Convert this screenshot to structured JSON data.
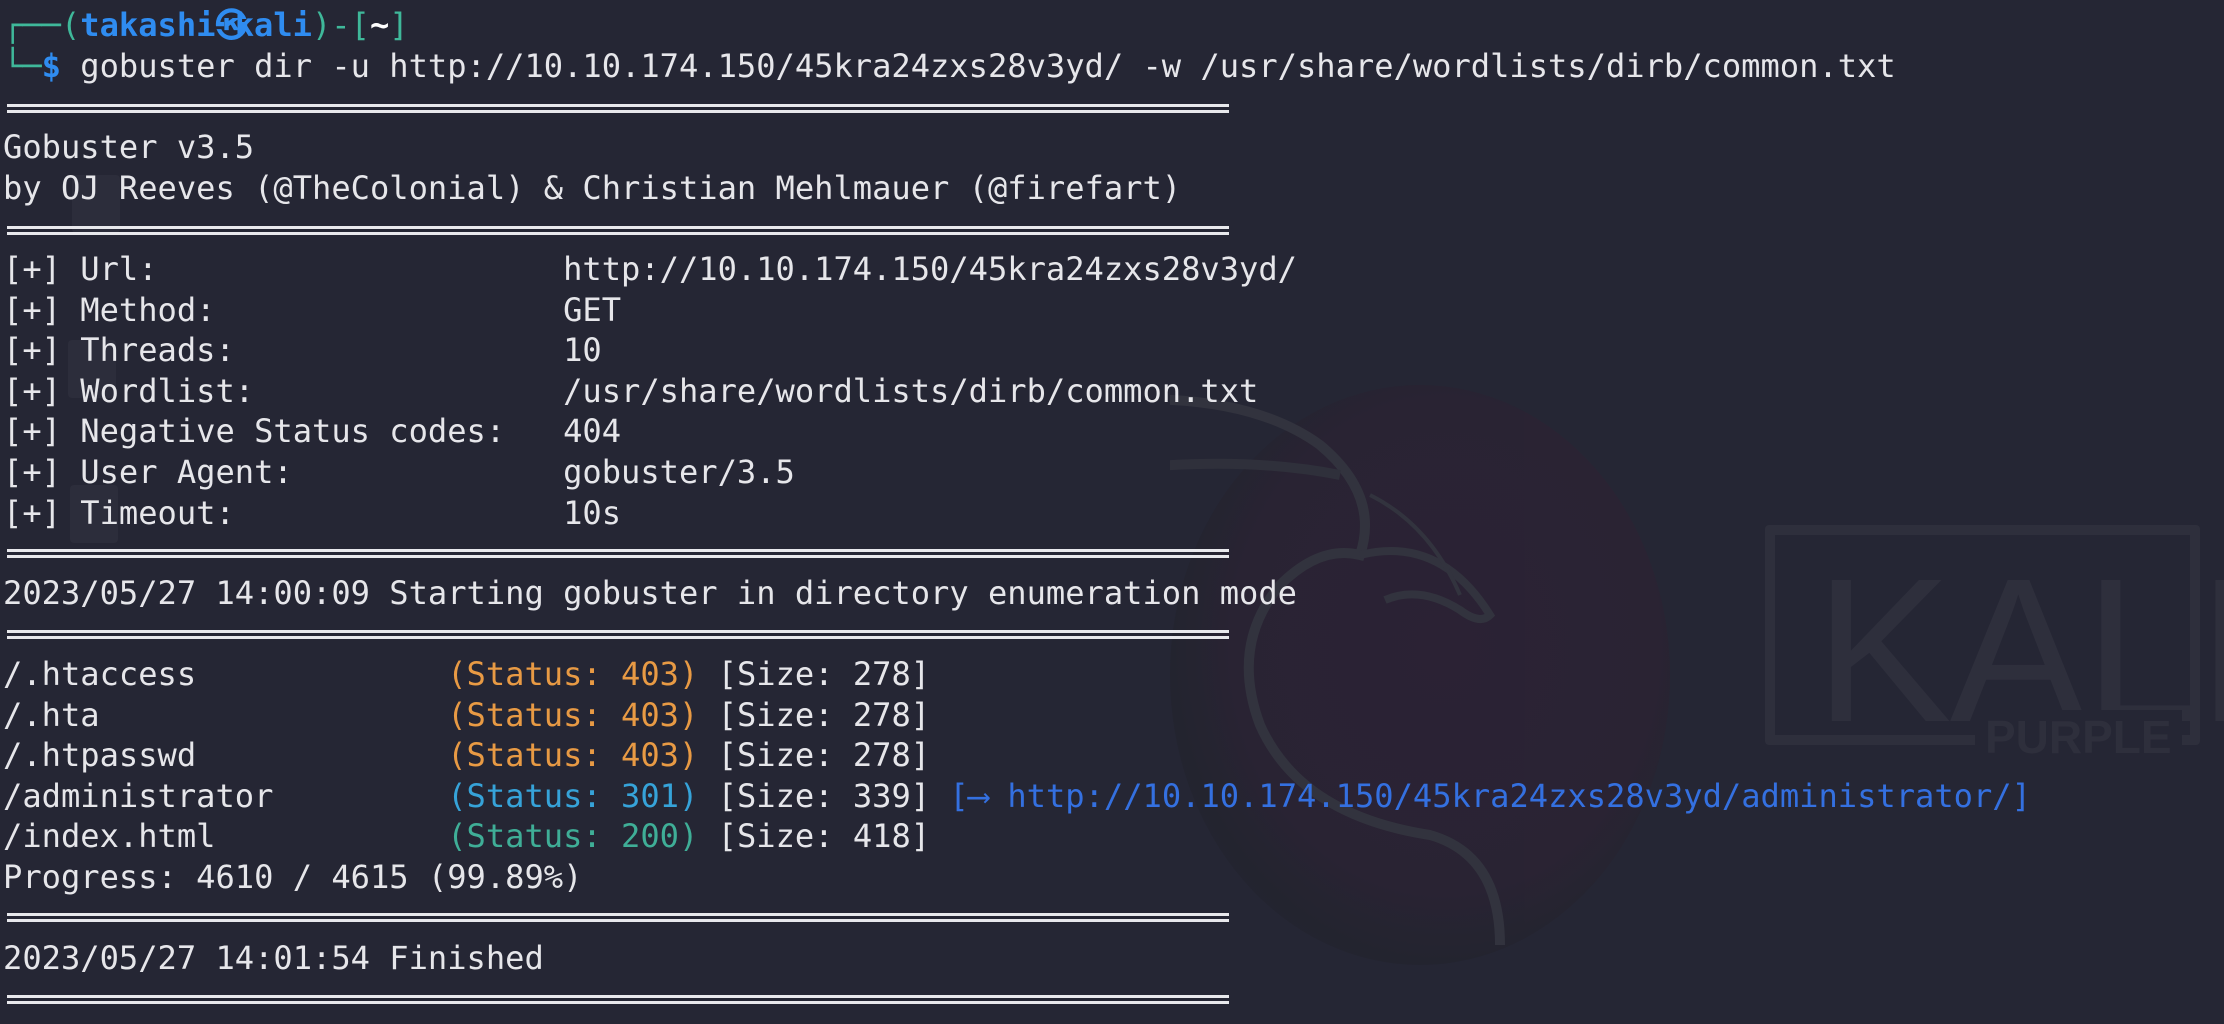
{
  "prompt": {
    "user": "takashi",
    "host": "kali",
    "cwd": "~",
    "symbol": "$",
    "separator_icon": "kali-circle-icon",
    "command": "gobuster dir -u http://10.10.174.150/45kra24zxs28v3yd/ -w /usr/share/wordlists/dirb/common.txt"
  },
  "banner": {
    "title": "Gobuster v3.5",
    "authors": "by OJ Reeves (@TheColonial) & Christian Mehlmauer (@firefart)"
  },
  "config": [
    {
      "prefix": "[+]",
      "key": "Url:                     ",
      "value": "http://10.10.174.150/45kra24zxs28v3yd/"
    },
    {
      "prefix": "[+]",
      "key": "Method:                  ",
      "value": "GET"
    },
    {
      "prefix": "[+]",
      "key": "Threads:                 ",
      "value": "10"
    },
    {
      "prefix": "[+]",
      "key": "Wordlist:                ",
      "value": "/usr/share/wordlists/dirb/common.txt"
    },
    {
      "prefix": "[+]",
      "key": "Negative Status codes:   ",
      "value": "404"
    },
    {
      "prefix": "[+]",
      "key": "User Agent:              ",
      "value": "gobuster/3.5"
    },
    {
      "prefix": "[+]",
      "key": "Timeout:                 ",
      "value": "10s"
    }
  ],
  "start_message": "2023/05/27 14:00:09 Starting gobuster in directory enumeration mode",
  "results": [
    {
      "path": "/.htaccess            ",
      "status": "(Status: 403)",
      "size": "[Size: 278]",
      "status_class": "orange"
    },
    {
      "path": "/.hta                 ",
      "status": "(Status: 403)",
      "size": "[Size: 278]",
      "status_class": "orange"
    },
    {
      "path": "/.htpasswd            ",
      "status": "(Status: 403)",
      "size": "[Size: 278]",
      "status_class": "orange"
    },
    {
      "path": "/administrator        ",
      "status": "(Status: 301)",
      "size": "[Size: 339]",
      "status_class": "cyan",
      "redirect": "[--> http://10.10.174.150/45kra24zxs28v3yd/administrator/]"
    },
    {
      "path": "/index.html           ",
      "status": "(Status: 200)",
      "size": "[Size: 418]",
      "status_class": "teal"
    }
  ],
  "progress": {
    "text": "Progress: 4610 / 4615 (99.89%)",
    "done": 4610,
    "total": 4615,
    "percent": 99.89
  },
  "finish_message": "2023/05/27 14:01:54 Finished",
  "colors": {
    "background": "#252634",
    "prompt_frame": "#3fb89a",
    "prompt_user": "#2f8cf0",
    "status_403": "#e89a44",
    "status_301": "#36a3d9",
    "status_200": "#3fae97",
    "redirect_link": "#3470e0"
  },
  "wallpaper": {
    "logo_text": "KALI",
    "logo_subtext": "PURPLE"
  }
}
